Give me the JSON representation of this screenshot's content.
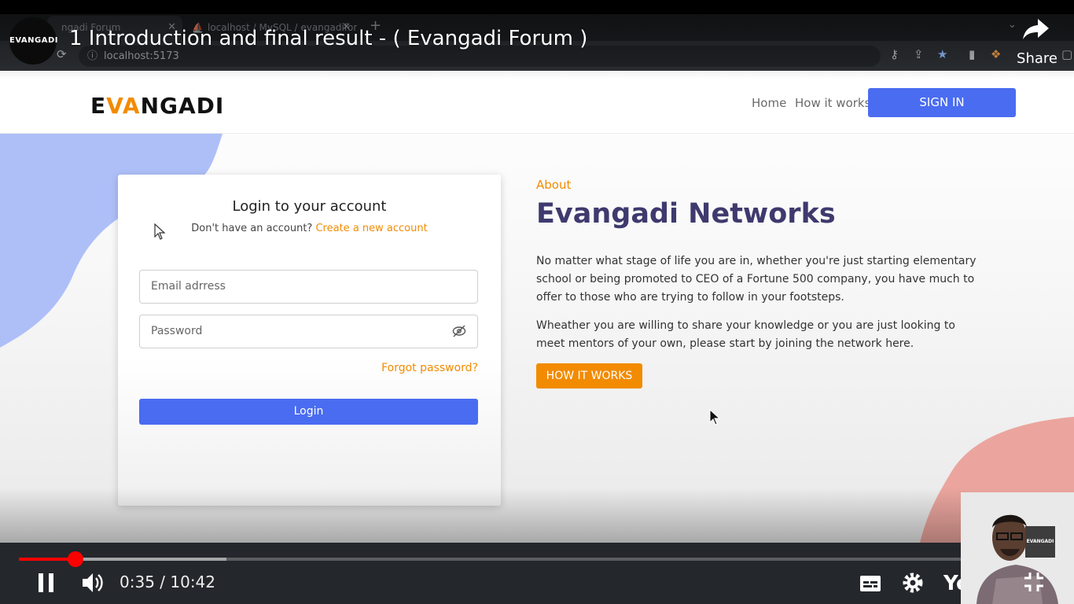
{
  "browser": {
    "tabs": [
      {
        "title": "ngadi Forum"
      },
      {
        "title": "localhost / MySQL / evangadifor"
      }
    ],
    "new_tab": "+",
    "url": "localhost:5173"
  },
  "site": {
    "logo": {
      "part1": "E",
      "part2": "VA",
      "part3": "NGADI"
    },
    "nav": {
      "home": "Home",
      "how_it_works": "How it works",
      "sign_in": "SIGN IN"
    },
    "login": {
      "title": "Login to your account",
      "subtitle": "Don't have an account?",
      "create_link": "Create a new account",
      "email_placeholder": "Email adrress",
      "password_placeholder": "Password",
      "forgot": "Forgot password?",
      "login_button": "Login"
    },
    "about": {
      "label": "About",
      "title": "Evangadi Networks",
      "paragraph1": "No matter what stage of life you are in, whether you're just starting elementary school or being promoted to CEO of a Fortune 500 company, you have much to offer to those who are trying to follow in your footsteps.",
      "paragraph2": "Wheather you are willing to share your knowledge or you are just looking to meet mentors of your own, please start by joining the network here.",
      "button": "HOW IT WORKS"
    },
    "colors": {
      "accent_orange": "#f28b00",
      "primary_blue": "#4a6cf0",
      "title_purple": "#3e3a6e"
    }
  },
  "youtube": {
    "channel_avatar": "EVANGADI",
    "title": "1 Introduction and final result - ( Evangadi Forum )",
    "share": "Share",
    "time": "0:35 / 10:42",
    "progress_fraction": 0.055,
    "buffer_fraction": 0.2,
    "logo": "YouTube",
    "pip_logo": "EVANGADI",
    "colors": {
      "progress": "#ff0000"
    }
  }
}
